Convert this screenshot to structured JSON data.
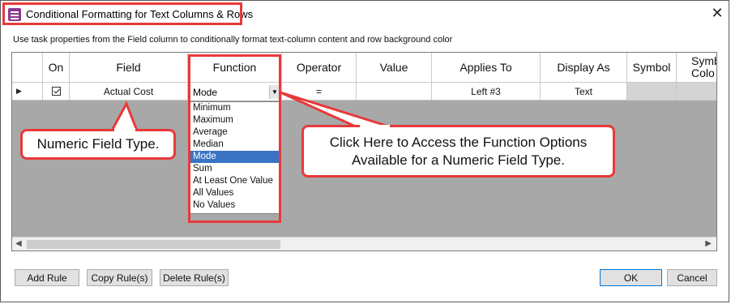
{
  "window": {
    "title": "Conditional Formatting for Text Columns & Rows",
    "close_glyph": "✕",
    "icon": "app-icon"
  },
  "instructions": "Use task properties from the Field column to conditionally format text-column content and row background color",
  "grid": {
    "headers": [
      "On",
      "Field",
      "Function",
      "Operator",
      "Value",
      "Applies To",
      "Display As",
      "Symbol",
      "Symb Colo"
    ],
    "row": {
      "pointer": "▶",
      "on_checked": true,
      "field": "Actual Cost",
      "function": "Mode",
      "operator": "=",
      "value": "",
      "applies_to": "Left #3",
      "display_as": "Text"
    },
    "function_options": [
      "Minimum",
      "Maximum",
      "Average",
      "Median",
      "Mode",
      "Sum",
      "At Least One Value",
      "All Values",
      "No Values"
    ],
    "selected_function": "Mode",
    "scroll_left": "◀",
    "scroll_right": "▶"
  },
  "callouts": {
    "left": "Numeric Field Type.",
    "right_line1": "Click Here to Access the Function Options",
    "right_line2": "Available for a Numeric Field Type."
  },
  "buttons": {
    "add_rule": "Add Rule",
    "copy_rules": "Copy Rule(s)",
    "delete_rules": "Delete Rule(s)",
    "ok": "OK",
    "cancel": "Cancel"
  },
  "colors": {
    "highlight": "#e8393a",
    "selection": "#3a73c4"
  }
}
